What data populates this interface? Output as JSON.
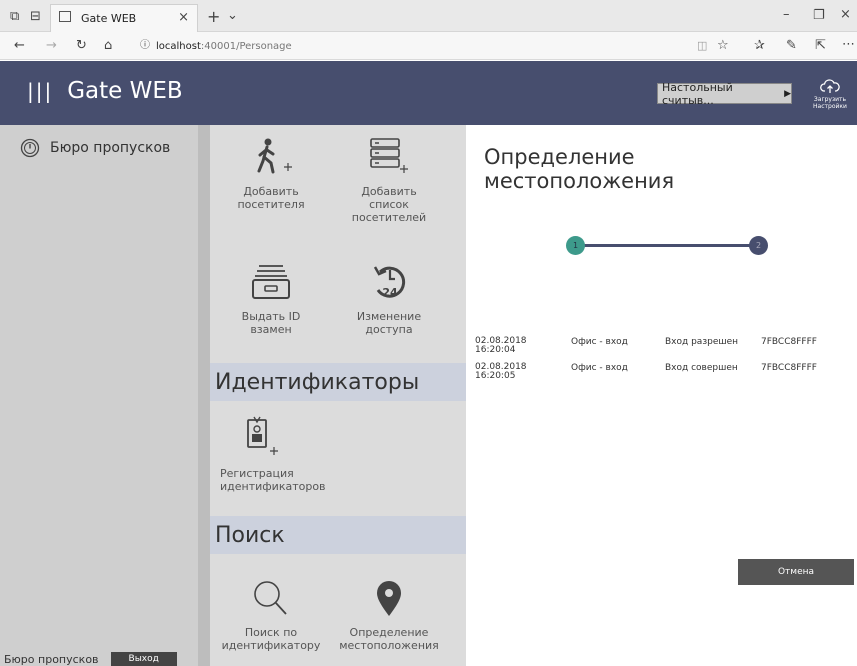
{
  "browser": {
    "tab_title": "Gate WEB",
    "url_host": "localhost",
    "url_rest": ":40001/Personage"
  },
  "header": {
    "app_title": "Gate WEB",
    "reader_label": "Настольный считыв...",
    "upload_label_1": "Загрузить",
    "upload_label_2": "Настройки"
  },
  "sidebar": {
    "title": "Бюро пропусков",
    "footer_label": "Бюро пропусков",
    "logout_label": "Выход"
  },
  "actions": [
    {
      "label1": "Добавить",
      "label2": "посетителя",
      "label3": ""
    },
    {
      "label1": "Добавить",
      "label2": "список",
      "label3": "посетителей"
    },
    {
      "label1": "Выдать ID",
      "label2": "взамен",
      "label3": ""
    },
    {
      "label1": "Изменение",
      "label2": "доступа",
      "label3": ""
    }
  ],
  "sections": {
    "ids_title": "Идентификаторы",
    "search_title": "Поиск"
  },
  "id_actions": [
    {
      "label1": "Регистрация",
      "label2": "идентификаторов"
    }
  ],
  "search_actions": [
    {
      "label1": "Поиск по",
      "label2": "идентификатору"
    },
    {
      "label1": "Определение",
      "label2": "местоположения"
    }
  ],
  "panel": {
    "title_line1": "Определение",
    "title_line2": "местоположения",
    "step1": "1",
    "step2": "2",
    "cancel_label": "Отмена"
  },
  "events": [
    {
      "date": "02.08.2018",
      "time": "16:20:04",
      "place": "Офис - вход",
      "status": "Вход разрешен",
      "id": "7FBCC8FFFF"
    },
    {
      "date": "02.08.2018",
      "time": "16:20:05",
      "place": "Офис - вход",
      "status": "Вход совершен",
      "id": "7FBCC8FFFF"
    }
  ],
  "colors": {
    "header_bg": "#474e6e",
    "step_active": "#3d9a8b",
    "step_inactive": "#474e6e"
  }
}
